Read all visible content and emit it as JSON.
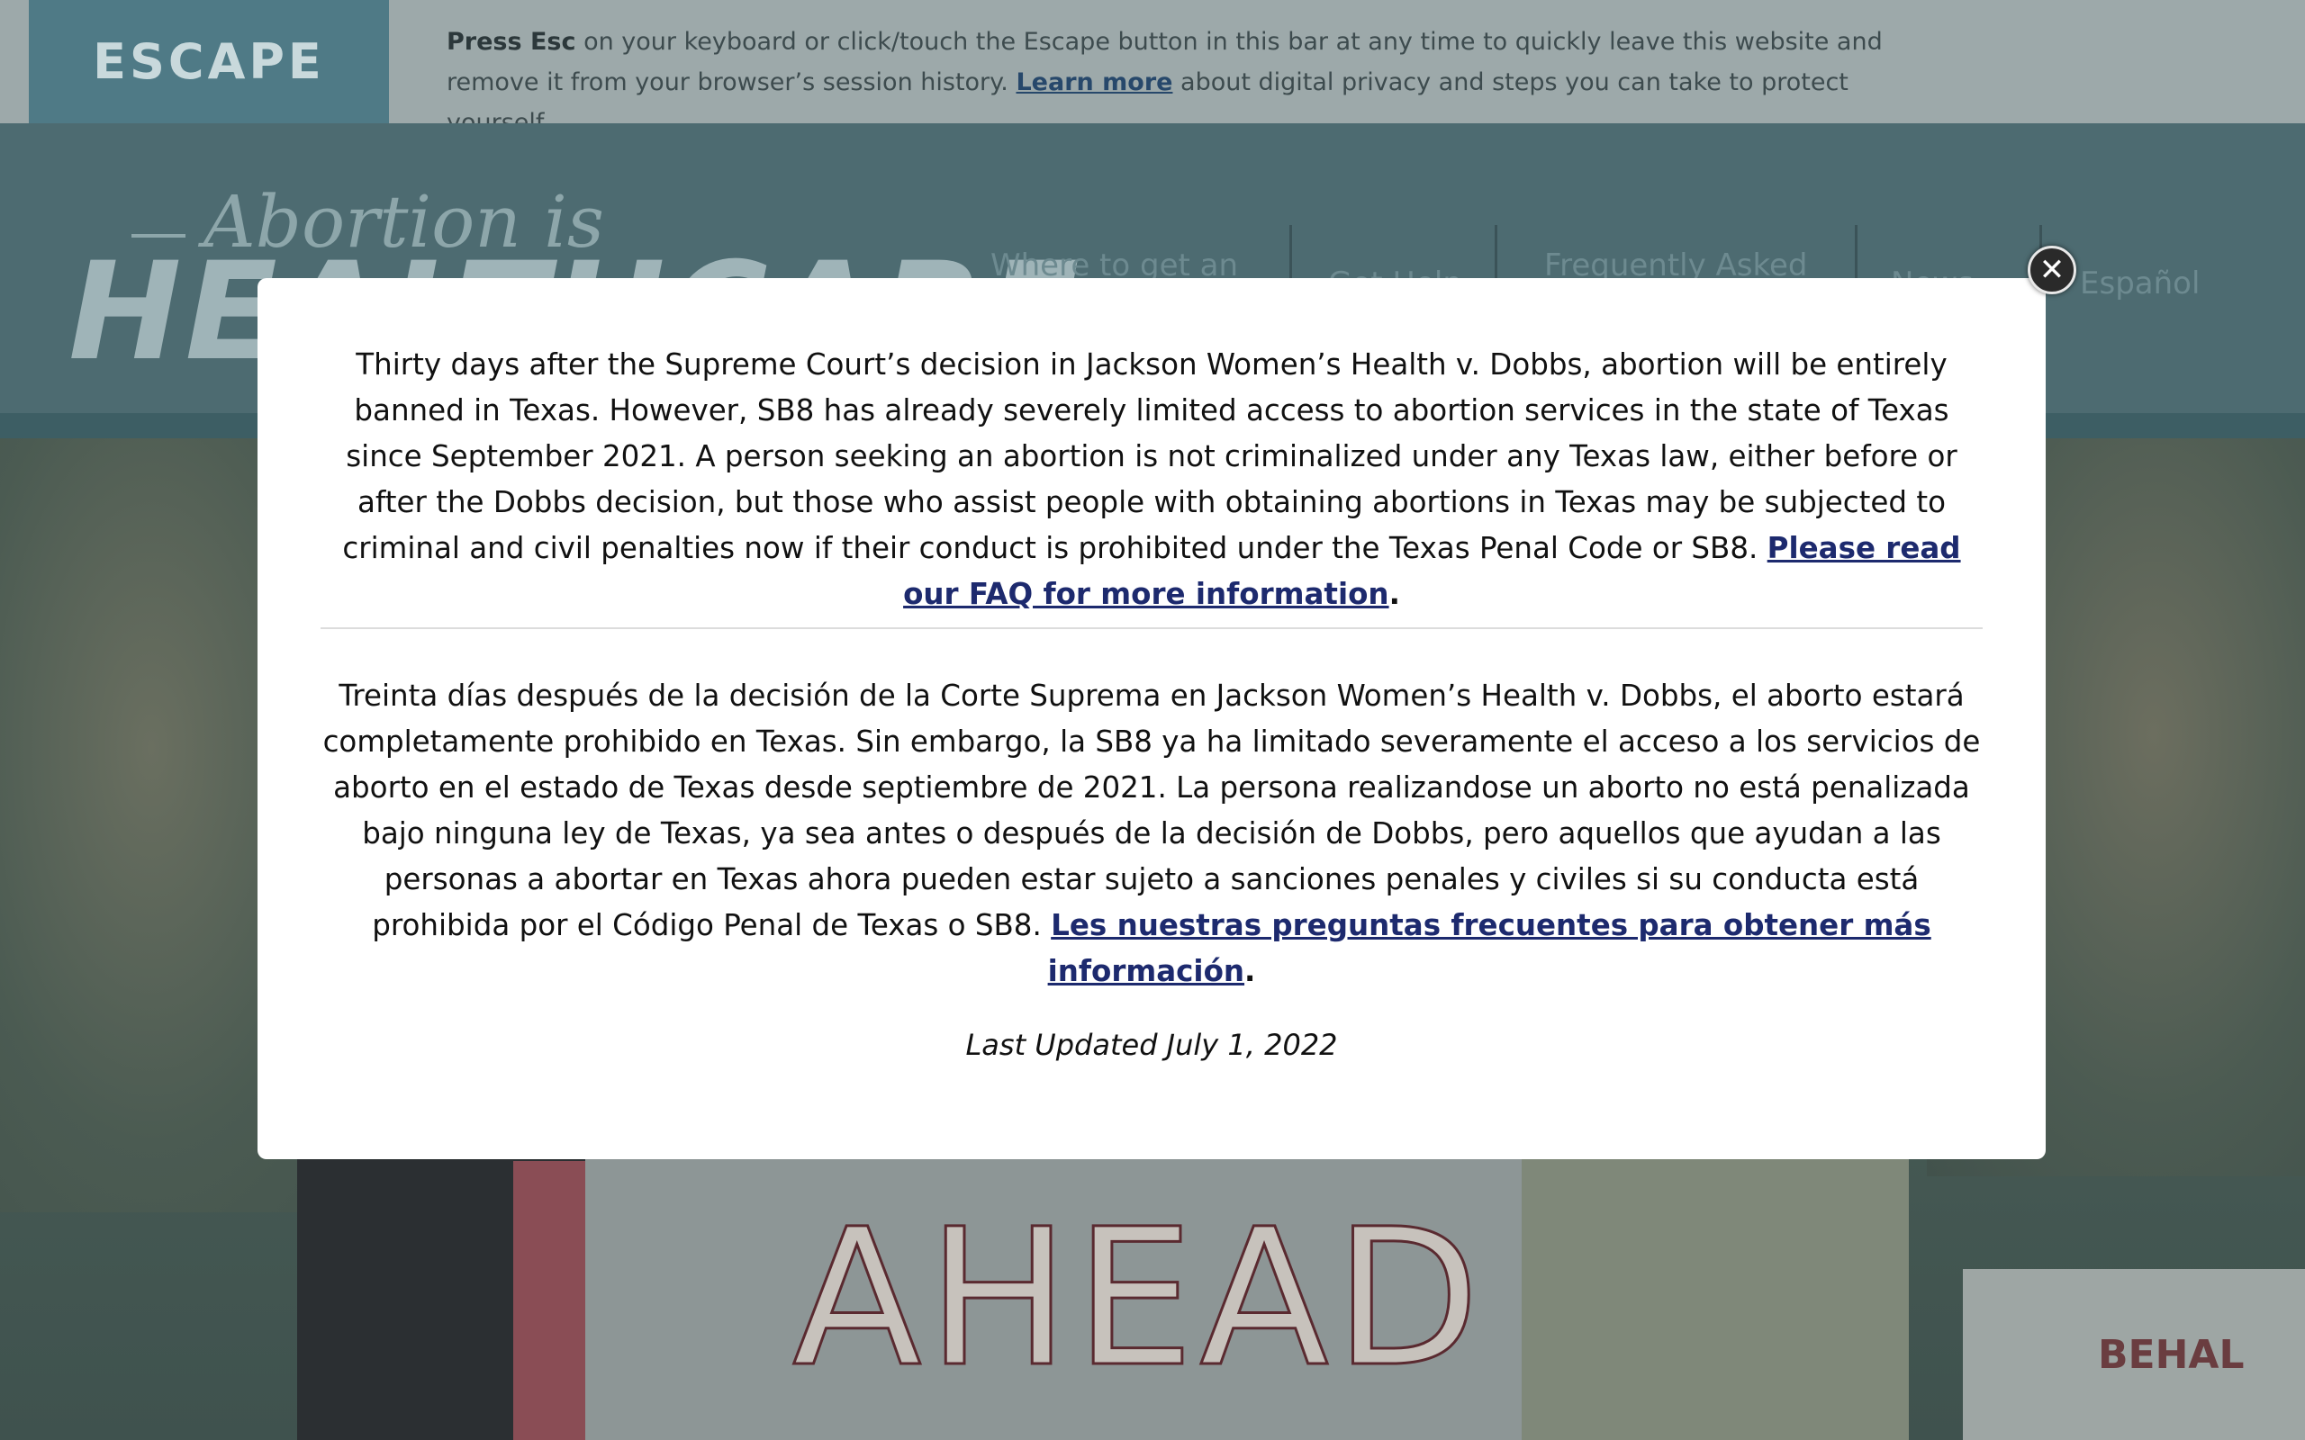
{
  "escape_bar": {
    "button_label": "ESCAPE",
    "text_strong": "Press Esc",
    "text_part1": " on your keyboard or click/touch the Escape button in this bar at any time to quickly leave this website and remove it from your browser’s session history. ",
    "learn_more_link": "Learn more",
    "text_part2": " about digital privacy and steps you can take to protect yourself."
  },
  "header": {
    "logo_script": "Abortion is",
    "logo_main": "HEALTHCARE",
    "nav": [
      "Where to get an",
      "Get Help",
      "Frequently Asked",
      "News",
      "Español"
    ]
  },
  "hero": {
    "sign_text": "AHEAD",
    "right_sign_text": "BEHAL"
  },
  "modal": {
    "en_text": "Thirty days after the Supreme Court’s decision in Jackson Women’s Health v. Dobbs, abortion will be entirely banned in Texas. However, SB8 has already severely limited access to abortion services in the state of Texas since September 2021.  A person seeking an abortion is not criminalized under any Texas law, either before or after the Dobbs decision, but those who assist people with obtaining abortions in Texas may be subjected to criminal and civil penalties now if their conduct is prohibited under the Texas Penal Code or SB8.  ",
    "en_link": "Please read our FAQ for more information",
    "en_end": ".",
    "es_text": "Treinta días después de la decisión de la Corte Suprema en Jackson Women’s Health v. Dobbs, el aborto estará completamente prohibido en Texas. Sin embargo, la SB8 ya ha limitado severamente el acceso a los servicios de aborto en el estado de Texas desde septiembre de 2021. La persona realizandose un aborto no está penalizada bajo ninguna ley de Texas, ya sea antes o después de la decisión de Dobbs, pero aquellos que ayudan a las personas a abortar en Texas ahora pueden estar sujeto a sanciones penales y civiles si su conducta está prohibida por el Código Penal de Texas o SB8. ",
    "es_link": "Les nuestras preguntas frecuentes para obtener más información",
    "es_end": ".",
    "last_updated": "Last Updated July 1, 2022",
    "close_icon": "close-icon"
  },
  "colors": {
    "escape_button": "#4f7a86",
    "header": "#4d6b71",
    "link": "#1d2a6e"
  }
}
